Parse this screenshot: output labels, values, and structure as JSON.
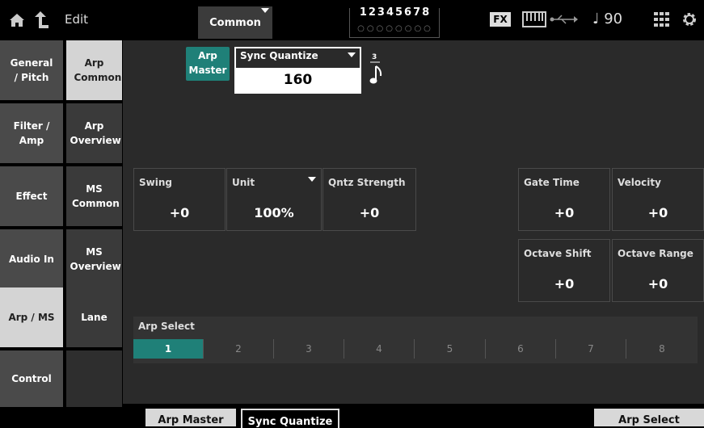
{
  "header": {
    "home_icon": "home-icon",
    "up_icon": "up-arrow-icon",
    "mode": "Edit",
    "common_label": "Common",
    "parts_numbers": "12345678",
    "parts_dots": "○○○○○○○○",
    "fx_label": "FX",
    "tempo": "♩ 90"
  },
  "left_tabs": [
    "General / Pitch",
    "Filter / Amp",
    "Effect",
    "Audio In",
    "Arp / MS",
    "Control"
  ],
  "sub_tabs": [
    "Arp Common",
    "Arp Overview",
    "MS Common",
    "MS Overview",
    "Lane"
  ],
  "arp_master": {
    "label_line1": "Arp",
    "label_line2": "Master"
  },
  "sync_quantize": {
    "label": "Sync Quantize",
    "value": "160",
    "note_tuplet": "3"
  },
  "params": {
    "swing": {
      "label": "Swing",
      "value": "+0"
    },
    "unit": {
      "label": "Unit",
      "value": "100%"
    },
    "qntz_strength": {
      "label": "Qntz Strength",
      "value": "+0"
    },
    "gate_time": {
      "label": "Gate Time",
      "value": "+0"
    },
    "velocity": {
      "label": "Velocity",
      "value": "+0"
    },
    "octave_shift": {
      "label": "Octave Shift",
      "value": "+0"
    },
    "octave_range": {
      "label": "Octave Range",
      "value": "+0"
    }
  },
  "arp_select": {
    "label": "Arp Select",
    "options": [
      "1",
      "2",
      "3",
      "4",
      "5",
      "6",
      "7",
      "8"
    ],
    "selected": "1"
  },
  "bottom": {
    "arp_master": "Arp Master",
    "sync_quantize": "Sync Quantize",
    "arp_select": "Arp Select"
  },
  "colors": {
    "accent": "#1f8078",
    "tab_active": "#d4d4d4",
    "tab_bg": "#4a4a4a",
    "panel": "#2a2a2a"
  }
}
